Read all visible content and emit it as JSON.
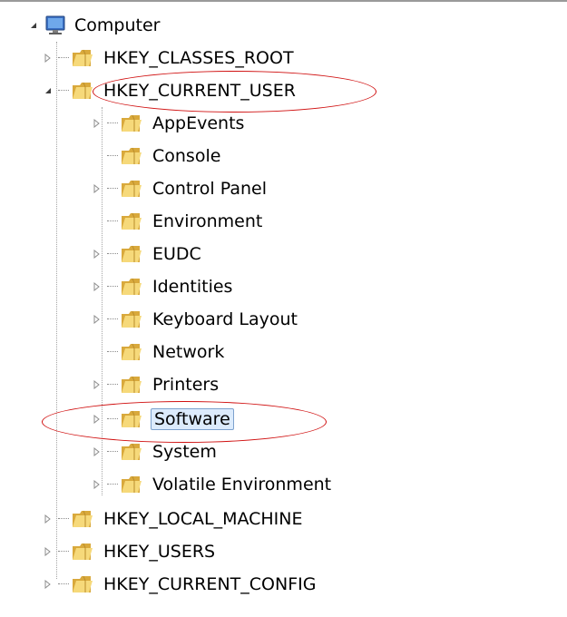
{
  "tree": {
    "root": {
      "label": "Computer",
      "icon": "computer-icon",
      "expanded": true
    },
    "hives": [
      {
        "label": "HKEY_CLASSES_ROOT",
        "expanded": false,
        "has_children": true
      },
      {
        "label": "HKEY_CURRENT_USER",
        "expanded": true,
        "has_children": true,
        "highlighted": true,
        "children": [
          {
            "label": "AppEvents",
            "has_children": true
          },
          {
            "label": "Console",
            "has_children": false
          },
          {
            "label": "Control Panel",
            "has_children": true
          },
          {
            "label": "Environment",
            "has_children": false
          },
          {
            "label": "EUDC",
            "has_children": true
          },
          {
            "label": "Identities",
            "has_children": true
          },
          {
            "label": "Keyboard Layout",
            "has_children": true
          },
          {
            "label": "Network",
            "has_children": false
          },
          {
            "label": "Printers",
            "has_children": true
          },
          {
            "label": "Software",
            "has_children": true,
            "selected": true,
            "highlighted": true
          },
          {
            "label": "System",
            "has_children": true
          },
          {
            "label": "Volatile Environment",
            "has_children": true
          }
        ]
      },
      {
        "label": "HKEY_LOCAL_MACHINE",
        "expanded": false,
        "has_children": true
      },
      {
        "label": "HKEY_USERS",
        "expanded": false,
        "has_children": true
      },
      {
        "label": "HKEY_CURRENT_CONFIG",
        "expanded": false,
        "has_children": true
      }
    ]
  },
  "colors": {
    "selection_bg": "#dcebfc",
    "selection_border": "#7da2ce",
    "annotation": "#d01010",
    "folder_light": "#f6d97a",
    "folder_dark": "#d9a93c"
  }
}
